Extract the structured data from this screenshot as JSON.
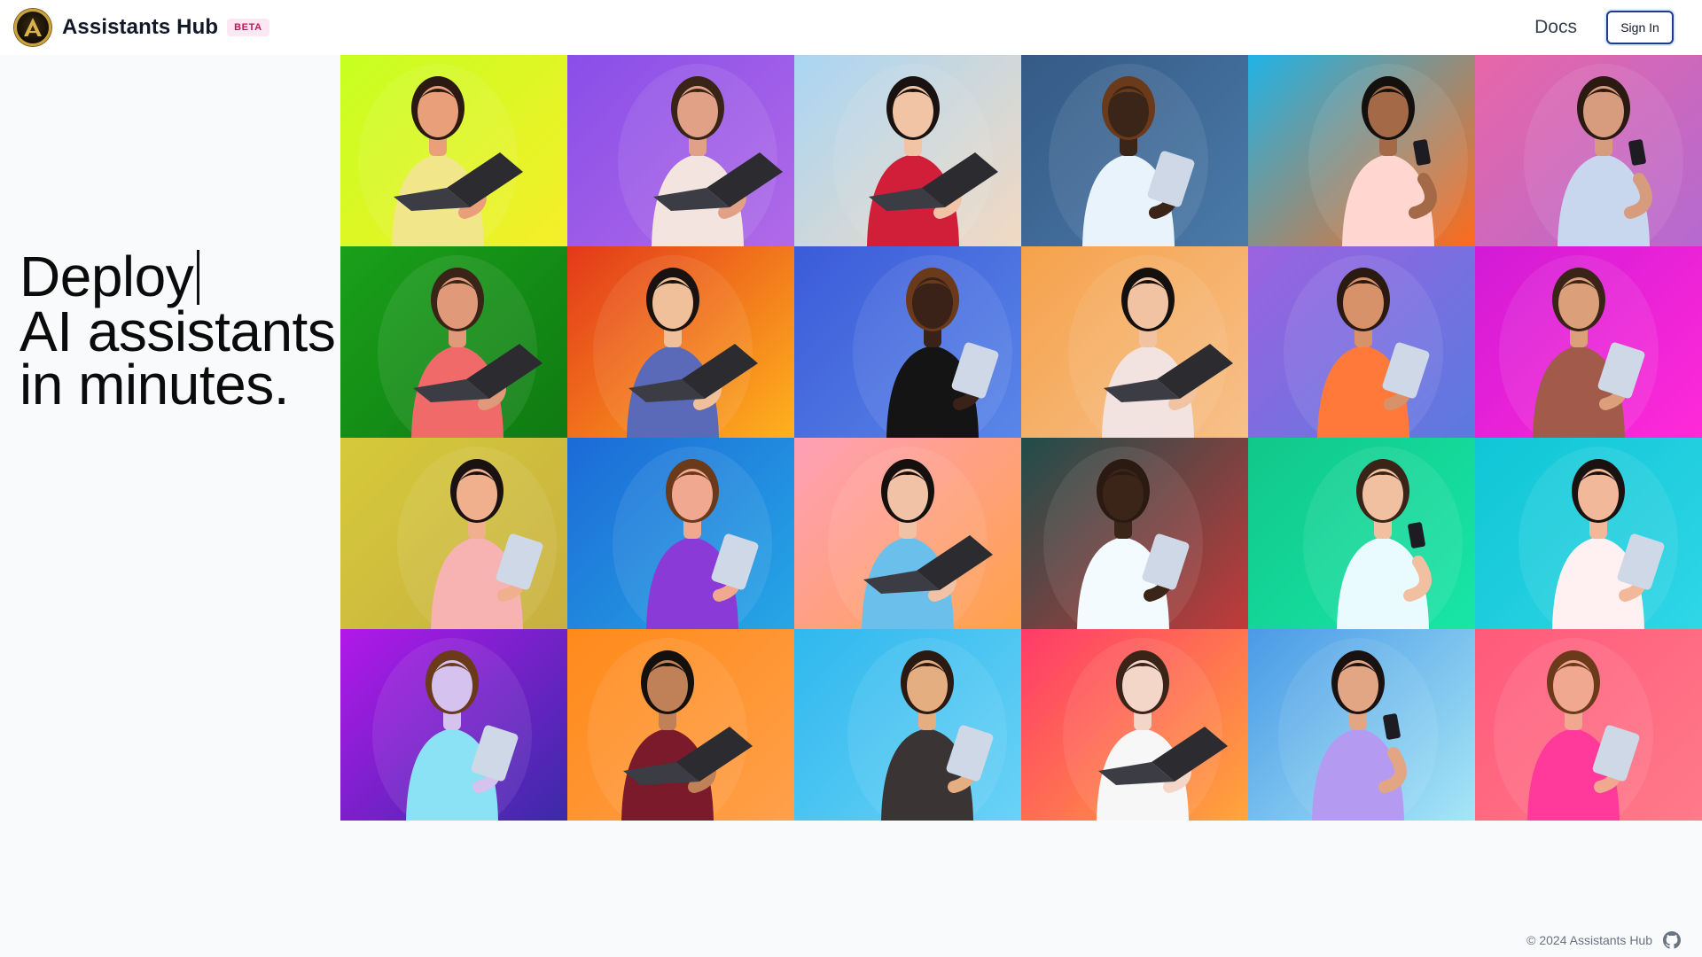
{
  "header": {
    "brand": "Assistants Hub",
    "badge": "BETA",
    "nav_docs": "Docs",
    "signin_label": "Sign In"
  },
  "hero": {
    "line1": "Deploy",
    "line2": "AI assistants",
    "line3": "in minutes."
  },
  "footer": {
    "copyright": "© 2024 Assistants Hub"
  },
  "grid": {
    "rows": 4,
    "columns": 6,
    "tiles": [
      {
        "bg": [
          "#c6ff20",
          "#f6ee2a"
        ],
        "skin": "#e9a07a",
        "shirt": "#f2e68a",
        "device": "laptop"
      },
      {
        "bg": [
          "#8a4ee8",
          "#b06ae8"
        ],
        "skin": "#e0a187",
        "shirt": "#f3e4e0",
        "device": "laptop"
      },
      {
        "bg": [
          "#a9d6f4",
          "#f2d9c2"
        ],
        "skin": "#f1c4a5",
        "shirt": "#d11f3a",
        "device": "laptop"
      },
      {
        "bg": [
          "#355a86",
          "#4a7aa8"
        ],
        "skin": "#3b2418",
        "shirt": "#e8f3fb",
        "device": "tablet"
      },
      {
        "bg": [
          "#1fb3e6",
          "#ff6a1a"
        ],
        "skin": "#a46a48",
        "shirt": "#ffd6d0",
        "device": "phone"
      },
      {
        "bg": [
          "#e866a8",
          "#b46ad0"
        ],
        "skin": "#d79b7e",
        "shirt": "#c8d6ee",
        "device": "phone"
      },
      {
        "bg": [
          "#1aa01a",
          "#0f7a12"
        ],
        "skin": "#e09a7a",
        "shirt": "#f06a6a",
        "device": "laptop"
      },
      {
        "bg": [
          "#e3381a",
          "#ffb21e"
        ],
        "skin": "#f0c09a",
        "shirt": "#5a6ab8",
        "device": "laptop"
      },
      {
        "bg": [
          "#3b5bd8",
          "#5a86e8"
        ],
        "skin": "#3a2218",
        "shirt": "#141414",
        "device": "tablet"
      },
      {
        "bg": [
          "#f6a24a",
          "#f7c08a"
        ],
        "skin": "#f1c3a2",
        "shirt": "#f3e3e0",
        "device": "laptop"
      },
      {
        "bg": [
          "#9c62e0",
          "#5a7ae0"
        ],
        "skin": "#d8926a",
        "shirt": "#ff7a3a",
        "device": "tablet"
      },
      {
        "bg": [
          "#d21ad6",
          "#ff2ad8"
        ],
        "skin": "#dba07a",
        "shirt": "#a25a4a",
        "device": "tablet"
      },
      {
        "bg": [
          "#d6c93a",
          "#c8b040"
        ],
        "skin": "#f0b08e",
        "shirt": "#f7b2b2",
        "device": "tablet"
      },
      {
        "bg": [
          "#1c6ad6",
          "#26a7e6"
        ],
        "skin": "#f0a890",
        "shirt": "#8a3ad6",
        "device": "tablet"
      },
      {
        "bg": [
          "#ff9fb8",
          "#ffa24a"
        ],
        "skin": "#f2c2a6",
        "shirt": "#6ac0ea",
        "device": "laptop"
      },
      {
        "bg": [
          "#1f4d4a",
          "#c23a3a"
        ],
        "skin": "#3b2418",
        "shirt": "#f4fbff",
        "device": "tablet"
      },
      {
        "bg": [
          "#10c88a",
          "#18e6a6"
        ],
        "skin": "#f1c0a0",
        "shirt": "#e9fbff",
        "device": "phone"
      },
      {
        "bg": [
          "#10c6d6",
          "#2fd6e6"
        ],
        "skin": "#f2b89a",
        "shirt": "#fff0f2",
        "device": "tablet"
      },
      {
        "bg": [
          "#b218ea",
          "#3a2aa8"
        ],
        "skin": "#d6c2ee",
        "shirt": "#8ae2f4",
        "device": "tablet"
      },
      {
        "bg": [
          "#ff8a1a",
          "#ffa04a"
        ],
        "skin": "#c08058",
        "shirt": "#7a1a2a",
        "device": "laptop"
      },
      {
        "bg": [
          "#2fb8ee",
          "#6ad2f6"
        ],
        "skin": "#e4ae80",
        "shirt": "#3a3434",
        "device": "tablet"
      },
      {
        "bg": [
          "#ff3a6a",
          "#ffa63a"
        ],
        "skin": "#f4d6c8",
        "shirt": "#f7f7f7",
        "device": "laptop"
      },
      {
        "bg": [
          "#4a9ae6",
          "#a6e6f6"
        ],
        "skin": "#e2a684",
        "shirt": "#b59af2",
        "device": "phone"
      },
      {
        "bg": [
          "#ff5a7a",
          "#ff7a8a"
        ],
        "skin": "#f0a890",
        "shirt": "#ff3a9a",
        "device": "tablet"
      }
    ]
  }
}
